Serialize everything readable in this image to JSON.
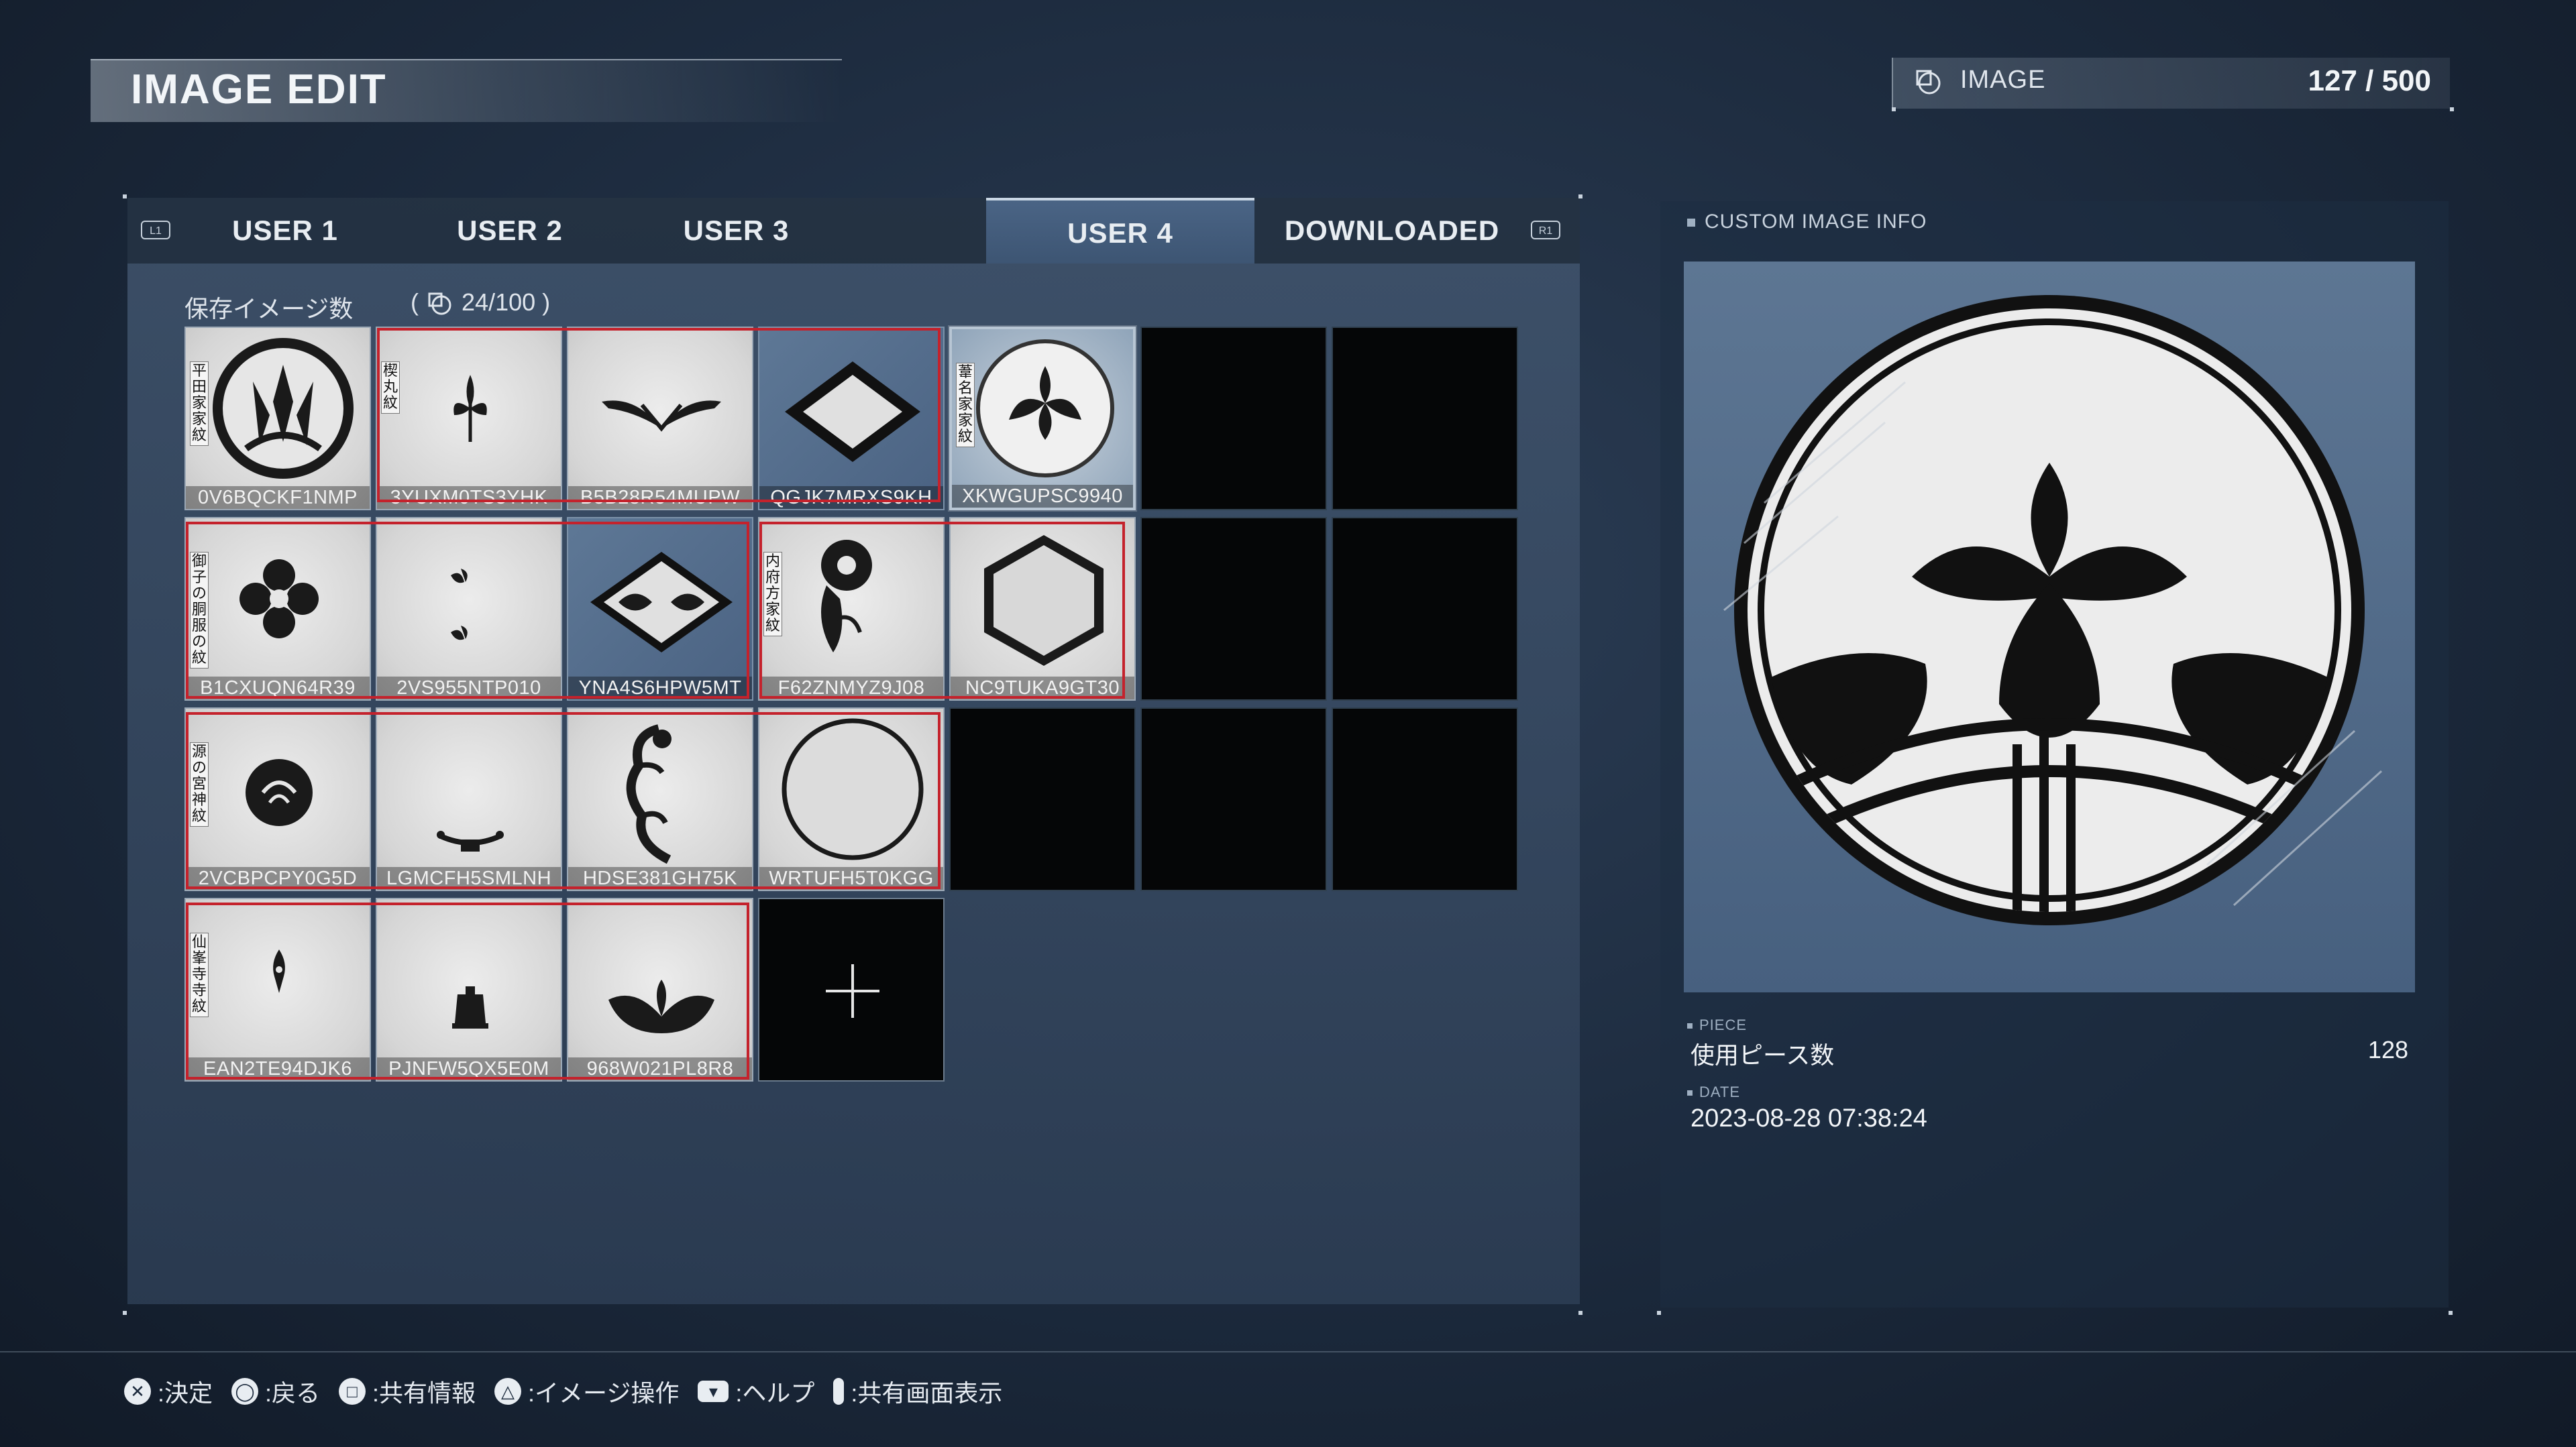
{
  "header": {
    "title": "IMAGE EDIT",
    "image_label": "IMAGE",
    "image_count": "127 / 500"
  },
  "tabs": {
    "left_shoulder": "L1",
    "right_shoulder": "R1",
    "items": [
      {
        "label": "USER 1",
        "active": false
      },
      {
        "label": "USER 2",
        "active": false
      },
      {
        "label": "USER 3",
        "active": false
      },
      {
        "label": "USER 4",
        "active": true
      },
      {
        "label": "DOWNLOADED",
        "active": false
      }
    ]
  },
  "saved": {
    "label": "保存イメージ数",
    "open_paren": "(",
    "count": "24/100",
    "close_paren": ")"
  },
  "grid": {
    "tiles": [
      {
        "code": "0V6BQCKF1NMP",
        "vlabel": "平田家 家紋",
        "icon": "bamboo-leaves-crest-icon"
      },
      {
        "code": "3YUXM0TS3YHK",
        "vlabel": "楔丸 紋",
        "icon": "sprout-icon"
      },
      {
        "code": "B5B28R54MUPW",
        "vlabel": "",
        "icon": "wings-icon"
      },
      {
        "code": "QGJK7MRXS9KH",
        "vlabel": "",
        "icon": "diamond-frame-icon"
      },
      {
        "code": "XKWGUPSC9940",
        "vlabel": "葦名家 家紋",
        "icon": "iris-crest-icon"
      },
      {
        "code": "B1CXUQN64R39",
        "vlabel": "御子の胴服の紋",
        "icon": "flower-crest-icon"
      },
      {
        "code": "2VS955NTP010",
        "vlabel": "",
        "icon": "twin-sprouts-icon"
      },
      {
        "code": "YNA4S6HPW5MT",
        "vlabel": "",
        "icon": "diamond-leaves-icon"
      },
      {
        "code": "F62ZNMYZ9J08",
        "vlabel": "内府方 家紋",
        "icon": "chrysanthemum-crest-icon"
      },
      {
        "code": "NC9TUKA9GT30",
        "vlabel": "",
        "icon": "hexagon-icon"
      },
      {
        "code": "2VCBPCPY0G5D",
        "vlabel": "源の宮 神紋",
        "icon": "tomoe-icon"
      },
      {
        "code": "LGMCFH5SMLNH",
        "vlabel": "",
        "icon": "stand-icon"
      },
      {
        "code": "HDSE381GH75K",
        "vlabel": "",
        "icon": "fern-scroll-icon"
      },
      {
        "code": "WRTUFH5T0KGG",
        "vlabel": "",
        "icon": "ring-icon"
      },
      {
        "code": "EAN2TE94DJK6",
        "vlabel": "仙峯寺 寺紋",
        "icon": "small-flame-icon"
      },
      {
        "code": "PJNFW5QX5E0M",
        "vlabel": "",
        "icon": "bell-icon"
      },
      {
        "code": "968W021PL8R8",
        "vlabel": "",
        "icon": "ginkgo-icon"
      }
    ],
    "add_label": "+"
  },
  "info": {
    "title": "CUSTOM IMAGE INFO",
    "piece_head": "PIECE",
    "piece_label": "使用ピース数",
    "piece_value": "128",
    "date_head": "DATE",
    "date_value": "2023-08-28 07:38:24"
  },
  "footer": {
    "items": [
      {
        "glyph": "✕",
        "label": ":決定"
      },
      {
        "glyph": "◯",
        "label": ":戻る"
      },
      {
        "glyph": "□",
        "label": ":共有情報"
      },
      {
        "glyph": "△",
        "label": ":イメージ操作"
      },
      {
        "glyph": "▾",
        "label": ":ヘルプ"
      },
      {
        "glyph": "",
        "label": ":共有画面表示"
      }
    ]
  },
  "colors": {
    "accent_red": "#c4222c",
    "panel_blue": "#4a6485",
    "tile_gray": "#d6d6d6"
  }
}
